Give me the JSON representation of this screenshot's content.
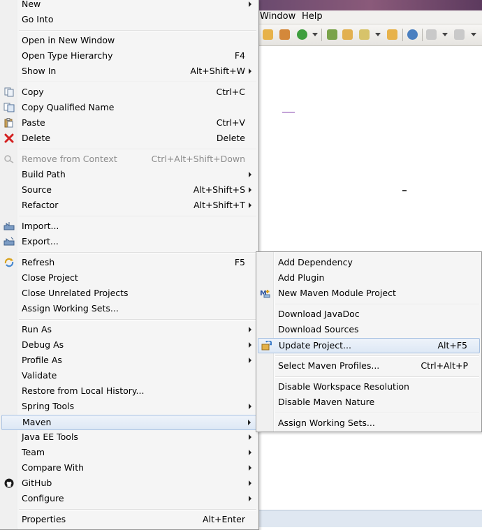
{
  "background": {
    "menubar": [
      "Window",
      "Help"
    ]
  },
  "context_menu": {
    "items": [
      {
        "label": "New",
        "shortcut": "",
        "submenu": true
      },
      {
        "label": "Go Into",
        "shortcut": ""
      },
      {
        "label": "Open in New Window",
        "shortcut": ""
      },
      {
        "label": "Open Type Hierarchy",
        "shortcut": "F4"
      },
      {
        "label": "Show In",
        "shortcut": "Alt+Shift+W",
        "submenu": true
      },
      {
        "label": "Copy",
        "shortcut": "Ctrl+C",
        "icon": "copy-icon"
      },
      {
        "label": "Copy Qualified Name",
        "shortcut": "",
        "icon": "copy-qualified-name-icon"
      },
      {
        "label": "Paste",
        "shortcut": "Ctrl+V",
        "icon": "paste-icon"
      },
      {
        "label": "Delete",
        "shortcut": "Delete",
        "icon": "delete-icon"
      },
      {
        "label": "Remove from Context",
        "shortcut": "Ctrl+Alt+Shift+Down",
        "disabled": true,
        "icon": "remove-context-icon"
      },
      {
        "label": "Build Path",
        "shortcut": "",
        "submenu": true
      },
      {
        "label": "Source",
        "shortcut": "Alt+Shift+S",
        "submenu": true
      },
      {
        "label": "Refactor",
        "shortcut": "Alt+Shift+T",
        "submenu": true
      },
      {
        "label": "Import...",
        "shortcut": "",
        "icon": "import-icon"
      },
      {
        "label": "Export...",
        "shortcut": "",
        "icon": "export-icon"
      },
      {
        "label": "Refresh",
        "shortcut": "F5",
        "icon": "refresh-icon"
      },
      {
        "label": "Close Project",
        "shortcut": ""
      },
      {
        "label": "Close Unrelated Projects",
        "shortcut": ""
      },
      {
        "label": "Assign Working Sets...",
        "shortcut": ""
      },
      {
        "label": "Run As",
        "shortcut": "",
        "submenu": true
      },
      {
        "label": "Debug As",
        "shortcut": "",
        "submenu": true
      },
      {
        "label": "Profile As",
        "shortcut": "",
        "submenu": true
      },
      {
        "label": "Validate",
        "shortcut": ""
      },
      {
        "label": "Restore from Local History...",
        "shortcut": ""
      },
      {
        "label": "Spring Tools",
        "shortcut": "",
        "submenu": true
      },
      {
        "label": "Maven",
        "shortcut": "",
        "submenu": true,
        "highlighted": true
      },
      {
        "label": "Java EE Tools",
        "shortcut": "",
        "submenu": true
      },
      {
        "label": "Team",
        "shortcut": "",
        "submenu": true
      },
      {
        "label": "Compare With",
        "shortcut": "",
        "submenu": true
      },
      {
        "label": "GitHub",
        "shortcut": "",
        "submenu": true,
        "icon": "github-icon"
      },
      {
        "label": "Configure",
        "shortcut": "",
        "submenu": true
      },
      {
        "label": "Properties",
        "shortcut": "Alt+Enter"
      }
    ]
  },
  "maven_submenu": {
    "items": [
      {
        "label": "Add Dependency",
        "shortcut": ""
      },
      {
        "label": "Add Plugin",
        "shortcut": ""
      },
      {
        "label": "New Maven Module Project",
        "shortcut": "",
        "icon": "maven-module-icon"
      },
      {
        "label": "Download JavaDoc",
        "shortcut": ""
      },
      {
        "label": "Download Sources",
        "shortcut": ""
      },
      {
        "label": "Update Project...",
        "shortcut": "Alt+F5",
        "highlighted": true,
        "icon": "update-project-icon"
      },
      {
        "label": "Select Maven Profiles...",
        "shortcut": "Ctrl+Alt+P"
      },
      {
        "label": "Disable Workspace Resolution",
        "shortcut": ""
      },
      {
        "label": "Disable Maven Nature",
        "shortcut": ""
      },
      {
        "label": "Assign Working Sets...",
        "shortcut": ""
      }
    ]
  }
}
